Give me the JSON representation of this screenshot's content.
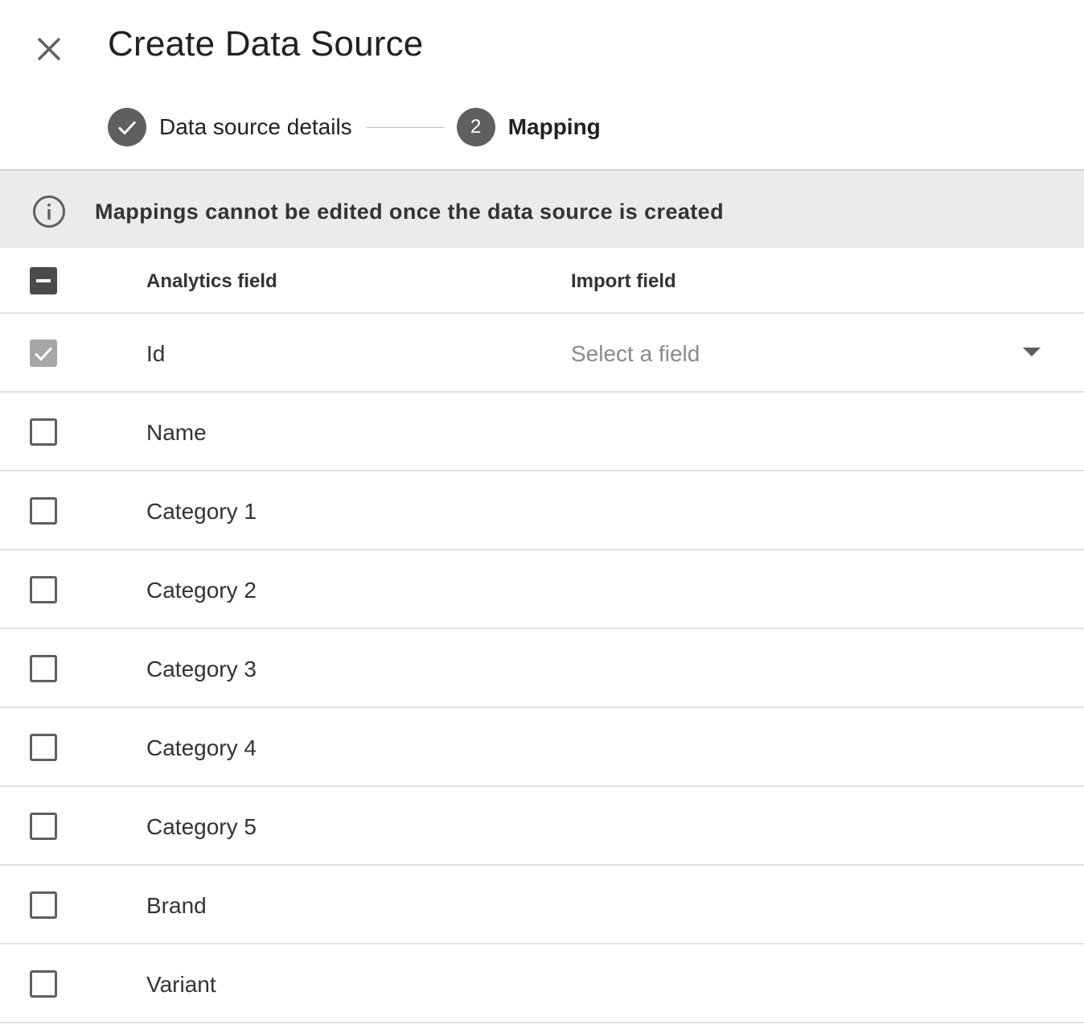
{
  "header": {
    "title": "Create Data Source",
    "close_icon": "close-icon"
  },
  "stepper": {
    "steps": [
      {
        "label": "Data source details",
        "state": "completed",
        "icon": "check-icon"
      },
      {
        "label": "Mapping",
        "state": "active",
        "number": "2"
      }
    ]
  },
  "banner": {
    "icon": "info-icon",
    "text": "Mappings cannot be edited once the data source is created"
  },
  "table": {
    "columns": {
      "analytics": "Analytics field",
      "import": "Import field"
    },
    "header_checkbox_state": "indeterminate",
    "rows": [
      {
        "field": "Id",
        "checked": true,
        "disabled": true,
        "import_placeholder": "Select a field"
      },
      {
        "field": "Name",
        "checked": false
      },
      {
        "field": "Category 1",
        "checked": false
      },
      {
        "field": "Category 2",
        "checked": false
      },
      {
        "field": "Category 3",
        "checked": false
      },
      {
        "field": "Category 4",
        "checked": false
      },
      {
        "field": "Category 5",
        "checked": false
      },
      {
        "field": "Brand",
        "checked": false
      },
      {
        "field": "Variant",
        "checked": false
      }
    ]
  },
  "colors": {
    "banner_bg": "#ebebeb",
    "step_circle": "#5f5f5f",
    "divider": "#e0e0e0"
  }
}
